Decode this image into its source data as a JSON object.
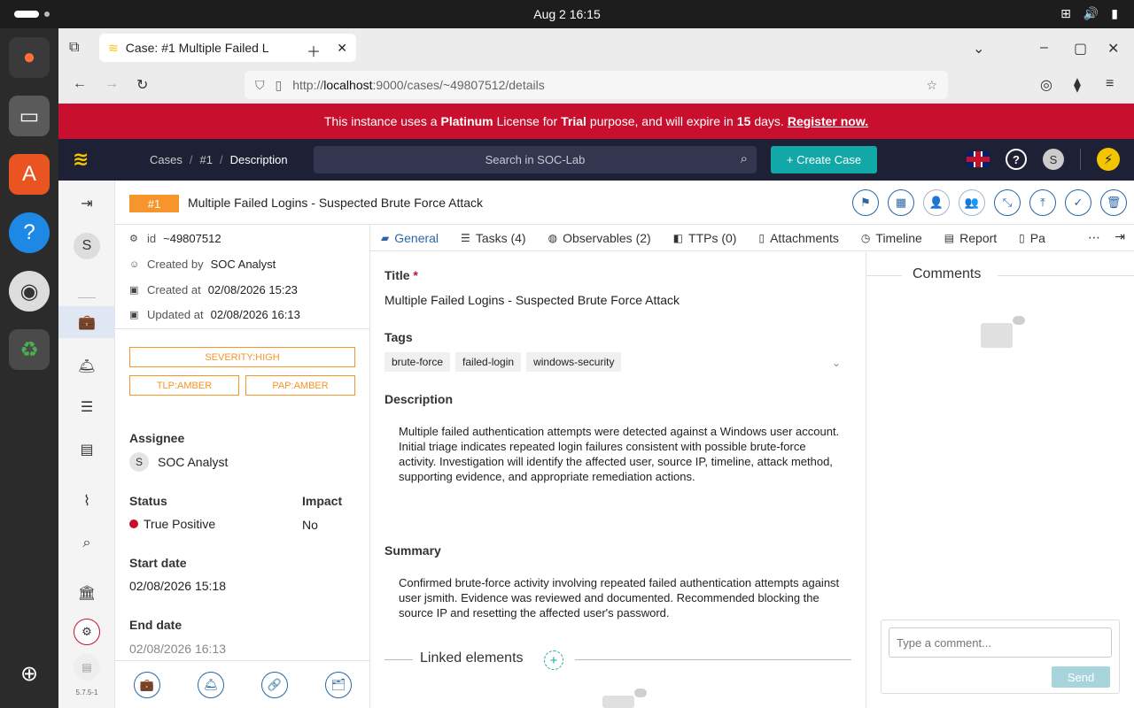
{
  "os": {
    "clock": "Aug 2  16:15"
  },
  "browser": {
    "tab_title": "Case: #1 Multiple Failed L",
    "url_scheme": "http://",
    "url_host": "localhost",
    "url_rest": ":9000/cases/~49807512/details"
  },
  "license": {
    "pre": "This instance uses a",
    "plan": "Platinum",
    "mid": "License for",
    "purpose": "Trial",
    "mid2": "purpose, and will expire in",
    "days": "15",
    "post": "days.",
    "link": "Register now."
  },
  "appbar": {
    "breadcrumb": [
      "Cases",
      "#1",
      "Description"
    ],
    "search_placeholder": "Search in SOC-Lab",
    "create_label": "+ Create Case",
    "avatar": "S"
  },
  "sidenav": {
    "avatar": "S",
    "version": "5.7.5-1"
  },
  "case": {
    "number": "#1",
    "title": "Multiple Failed Logins - Suspected Brute Force Attack",
    "id_label": "id",
    "id": "~49807512",
    "created_by_label": "Created by",
    "created_by": "SOC Analyst",
    "created_at_label": "Created at",
    "created_at": "02/08/2026 15:23",
    "updated_at_label": "Updated at",
    "updated_at": "02/08/2026 16:13",
    "severity": "SEVERITY:HIGH",
    "tlp": "TLP:AMBER",
    "pap": "PAP:AMBER",
    "assignee_label": "Assignee",
    "assignee_initial": "S",
    "assignee": "SOC Analyst",
    "status_label": "Status",
    "status": "True Positive",
    "impact_label": "Impact",
    "impact": "No",
    "start_label": "Start date",
    "start": "02/08/2026 15:18",
    "end_label": "End date",
    "end": "02/08/2026 16:13"
  },
  "tabs": [
    {
      "label": "General"
    },
    {
      "label": "Tasks (4)"
    },
    {
      "label": "Observables (2)"
    },
    {
      "label": "TTPs (0)"
    },
    {
      "label": "Attachments"
    },
    {
      "label": "Timeline"
    },
    {
      "label": "Report"
    },
    {
      "label": "Pa"
    }
  ],
  "general": {
    "title_label": "Title",
    "title": "Multiple Failed Logins - Suspected Brute Force Attack",
    "tags_label": "Tags",
    "tags": [
      "brute-force",
      "failed-login",
      "windows-security"
    ],
    "description_label": "Description",
    "description": "Multiple failed authentication attempts were detected against a Windows user account. Initial triage indicates repeated login failures consistent with possible brute-force activity. Investigation will identify the affected user, source IP, timeline, attack method, supporting evidence, and appropriate remediation actions.",
    "summary_label": "Summary",
    "summary": "Confirmed brute-force activity involving repeated failed authentication attempts against user jsmith. Evidence was reviewed and documented. Recommended blocking the source IP and resetting the affected user's password.",
    "linked_label": "Linked elements"
  },
  "comments": {
    "title": "Comments",
    "placeholder": "Type a comment...",
    "send": "Send"
  },
  "colors": {
    "accent": "#2b67a5",
    "amber": "#f5952b",
    "banner": "#c8102e",
    "teal": "#13a8a8"
  }
}
